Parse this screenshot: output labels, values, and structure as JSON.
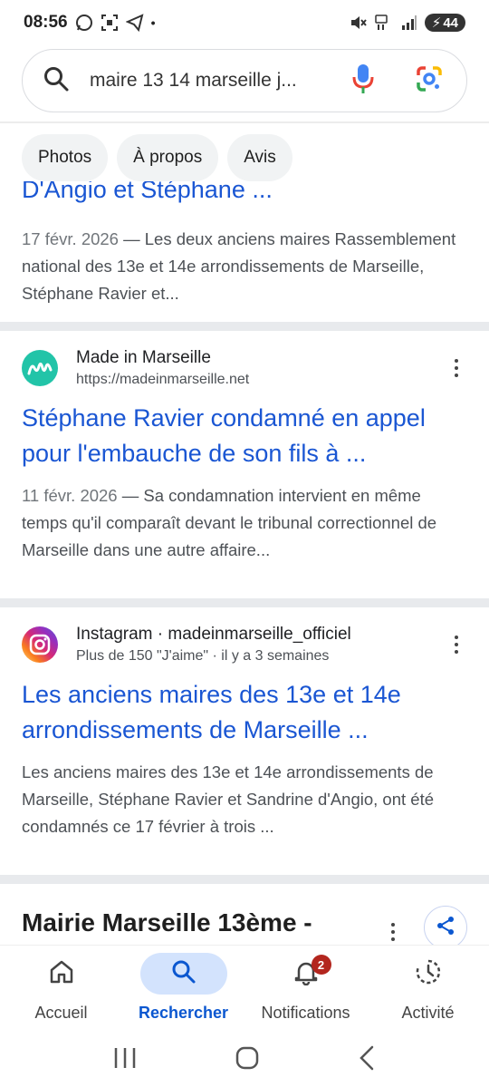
{
  "status_bar": {
    "time": "08:56",
    "battery": "44",
    "dot": "•"
  },
  "search": {
    "query": "maire 13 14 marseille j..."
  },
  "chips": [
    "Photos",
    "À propos",
    "Avis"
  ],
  "partial_result": {
    "title_cut": "D'Angio et Stéphane ...",
    "date": "17 févr. 2026",
    "snippet": " — Les deux anciens maires Rassemblement national des 13e et 14e arrondissements de Marseille, Stéphane Ravier et..."
  },
  "results": [
    {
      "site_name": "Made in Marseille",
      "site_url": "https://madeinmarseille.net",
      "title": "Stéphane Ravier condamné en appel pour l'embauche de son fils à ...",
      "date": "11 févr. 2026",
      "snippet": " — Sa condamnation intervient en même temps qu'il comparaît devant le tribunal correctionnel de Marseille dans une autre affaire..."
    },
    {
      "site_name": "Instagram · madeinmarseille_officiel",
      "site_url": "Plus de 150 \"J'aime\" · il y a 3 semaines",
      "title": "Les anciens maires des 13e et 14e arrondissements de Marseille ...",
      "snippet": "Les anciens maires des 13e et 14e arrondissements de Marseille, Stéphane Ravier et Sandrine d'Angio, ont été condamnés ce 17 février à trois ..."
    }
  ],
  "next_result": {
    "title": "Mairie Marseille 13ème -"
  },
  "bottom_nav": {
    "items": [
      {
        "label": "Accueil",
        "icon": "home-icon"
      },
      {
        "label": "Rechercher",
        "icon": "search-icon"
      },
      {
        "label": "Notifications",
        "icon": "bell-icon",
        "badge": "2"
      },
      {
        "label": "Activité",
        "icon": "history-icon"
      }
    ]
  },
  "colors": {
    "link": "#1a56d3",
    "active_nav_bg": "#d3e3fd",
    "badge": "#b3261e"
  }
}
